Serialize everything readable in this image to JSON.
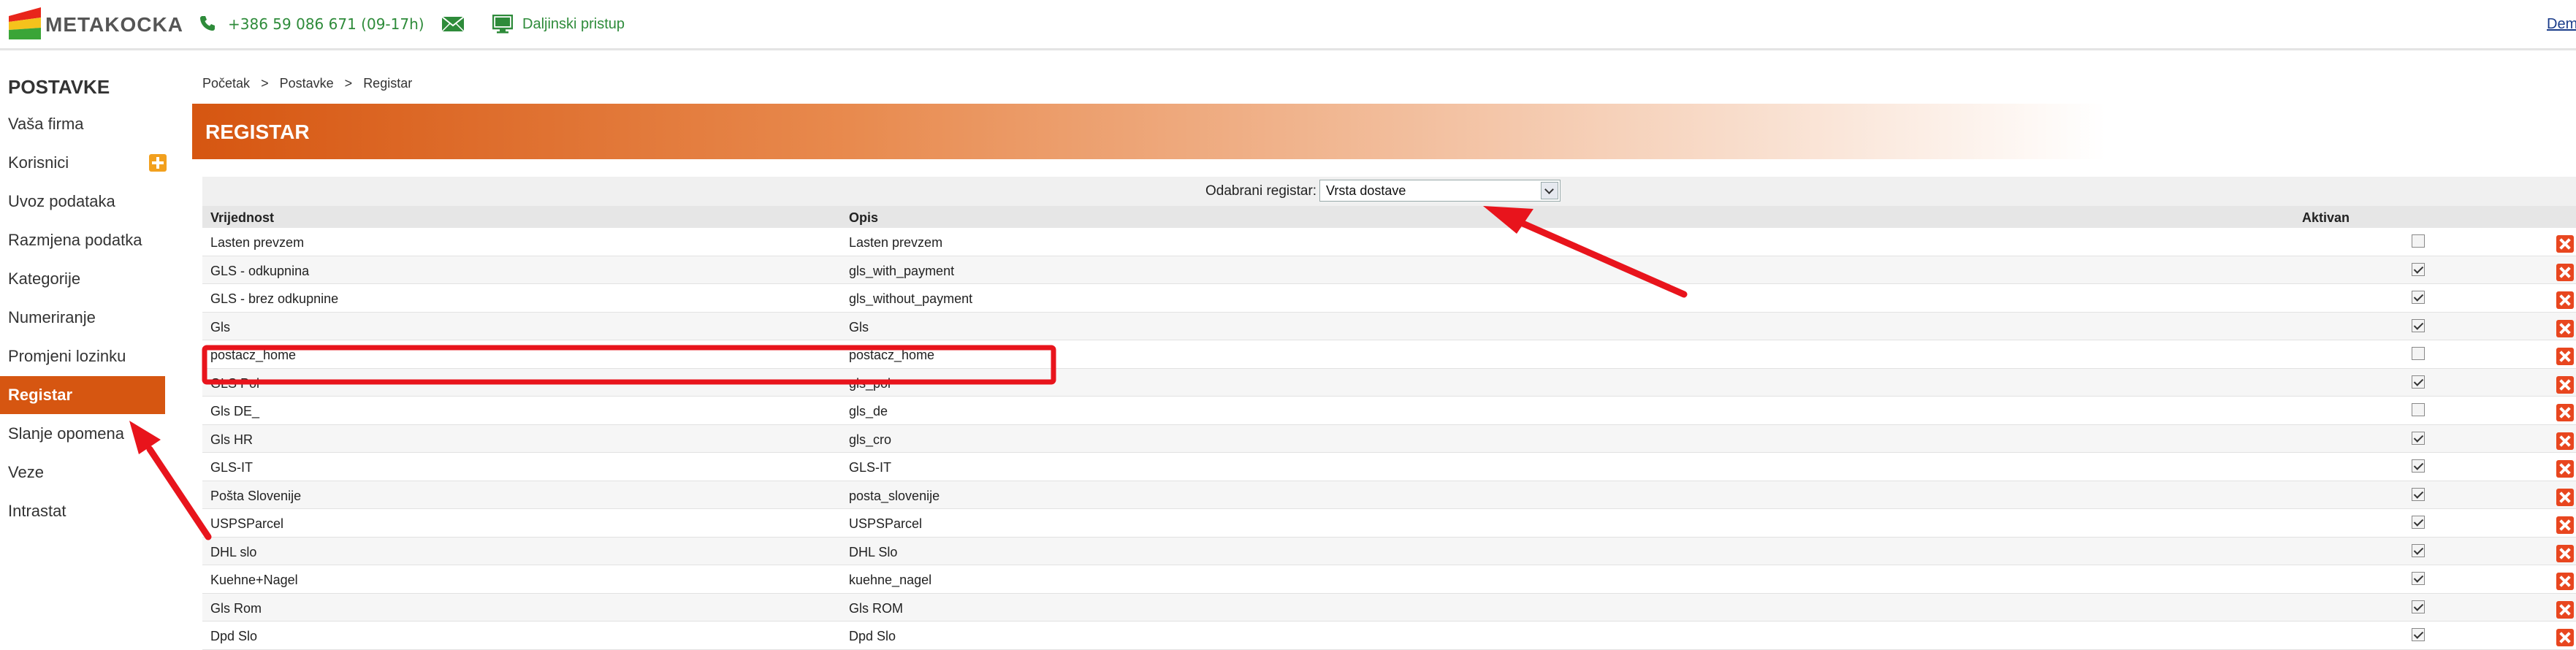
{
  "topbar": {
    "brand": "METAKOCKA",
    "phone": "+386 59 086 671",
    "phone_hours": "(09-17h)",
    "remote_access": "Daljinski pristup",
    "demo_link": "Dem"
  },
  "sidebar": {
    "title": "POSTAVKE",
    "items": [
      {
        "label": "Vaša firma"
      },
      {
        "label": "Korisnici"
      },
      {
        "label": "Uvoz podataka"
      },
      {
        "label": "Razmjena podatka"
      },
      {
        "label": "Kategorije"
      },
      {
        "label": "Numeriranje"
      },
      {
        "label": "Promjeni lozinku"
      },
      {
        "label": "Registar"
      },
      {
        "label": "Slanje opomena"
      },
      {
        "label": "Veze"
      },
      {
        "label": "Intrastat"
      }
    ],
    "active_item": "Registar"
  },
  "breadcrumb": {
    "items": [
      "Početak",
      "Postavke",
      "Registar"
    ],
    "separator": ">"
  },
  "page": {
    "title": "REGISTAR"
  },
  "filter": {
    "label": "Odabrani registar:",
    "selected": "Vrsta dostave"
  },
  "table": {
    "columns": [
      "Vrijednost",
      "Opis",
      "Aktivan"
    ],
    "rows": [
      {
        "value": "Lasten prevzem",
        "description": "Lasten prevzem",
        "active": false
      },
      {
        "value": "GLS - odkupnina",
        "description": "gls_with_payment",
        "active": true
      },
      {
        "value": "GLS - brez odkupnine",
        "description": "gls_without_payment",
        "active": true
      },
      {
        "value": "Gls",
        "description": "Gls",
        "active": true
      },
      {
        "value": "postacz_home",
        "description": "postacz_home",
        "active": false
      },
      {
        "value": "GLS Pol",
        "description": "gls_pol",
        "active": true
      },
      {
        "value": "Gls DE_",
        "description": "gls_de",
        "active": false
      },
      {
        "value": "Gls HR",
        "description": "gls_cro",
        "active": true
      },
      {
        "value": "GLS-IT",
        "description": "GLS-IT",
        "active": true
      },
      {
        "value": "Pošta Slovenije",
        "description": "posta_slovenije",
        "active": true
      },
      {
        "value": "USPSParcel",
        "description": "USPSParcel",
        "active": true
      },
      {
        "value": "DHL slo",
        "description": "DHL Slo",
        "active": true
      },
      {
        "value": "Kuehne+Nagel",
        "description": "kuehne_nagel",
        "active": true
      },
      {
        "value": "Gls Rom",
        "description": "Gls ROM",
        "active": true
      },
      {
        "value": "Dpd Slo",
        "description": "Dpd Slo",
        "active": true
      }
    ]
  },
  "colors": {
    "accent": "#d65611",
    "phone_green": "#2e8b3a",
    "annotation_red": "#e8141c",
    "delete_red": "#e8461f"
  },
  "icons": {
    "phone": "phone-icon",
    "mail": "mail-icon",
    "remote": "monitor-icon",
    "add_user": "plus-icon",
    "delete": "close-icon",
    "dropdown": "chevron-down-icon"
  }
}
